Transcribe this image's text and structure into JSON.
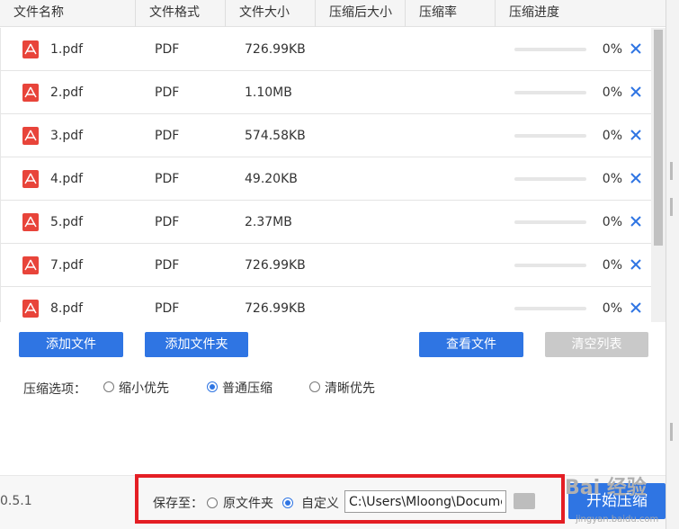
{
  "table": {
    "headers": [
      "文件名称",
      "文件格式",
      "文件大小",
      "压缩后大小",
      "压缩率",
      "压缩进度"
    ],
    "rows": [
      {
        "name": "1.pdf",
        "format": "PDF",
        "size": "726.99KB",
        "compressed": "",
        "ratio": "",
        "progress": 0,
        "progress_label": "0%"
      },
      {
        "name": "2.pdf",
        "format": "PDF",
        "size": "1.10MB",
        "compressed": "",
        "ratio": "",
        "progress": 0,
        "progress_label": "0%"
      },
      {
        "name": "3.pdf",
        "format": "PDF",
        "size": "574.58KB",
        "compressed": "",
        "ratio": "",
        "progress": 0,
        "progress_label": "0%"
      },
      {
        "name": "4.pdf",
        "format": "PDF",
        "size": "49.20KB",
        "compressed": "",
        "ratio": "",
        "progress": 0,
        "progress_label": "0%"
      },
      {
        "name": "5.pdf",
        "format": "PDF",
        "size": "2.37MB",
        "compressed": "",
        "ratio": "",
        "progress": 0,
        "progress_label": "0%"
      },
      {
        "name": "7.pdf",
        "format": "PDF",
        "size": "726.99KB",
        "compressed": "",
        "ratio": "",
        "progress": 0,
        "progress_label": "0%"
      },
      {
        "name": "8.pdf",
        "format": "PDF",
        "size": "726.99KB",
        "compressed": "",
        "ratio": "",
        "progress": 0,
        "progress_label": "0%"
      }
    ]
  },
  "actions": {
    "add_file": "添加文件",
    "add_folder": "添加文件夹",
    "view_files": "查看文件",
    "clear_list": "清空列表"
  },
  "options": {
    "label": "压缩选项：",
    "choices": [
      {
        "label": "缩小优先",
        "selected": false
      },
      {
        "label": "普通压缩",
        "selected": true
      },
      {
        "label": "清晰优先",
        "selected": false
      }
    ]
  },
  "footer": {
    "version": "0.5.1",
    "save_label": "保存至：",
    "save_options": [
      {
        "label": "原文件夹",
        "selected": false
      },
      {
        "label": "自定义",
        "selected": true
      }
    ],
    "path_value": "C:\\Users\\Mloong\\Documents",
    "start_button": "开始压缩"
  },
  "watermark": {
    "text": "Bai 经验",
    "sub": "jingyan.baidu.com"
  },
  "colors": {
    "accent": "#2f75e3",
    "pdf_icon": "#e8443a",
    "highlight_border": "#e41e24",
    "disabled_button": "#c9c9c9"
  },
  "icons": {
    "file_type": "pdf-icon",
    "remove": "close-icon",
    "browse": "folder-icon"
  }
}
